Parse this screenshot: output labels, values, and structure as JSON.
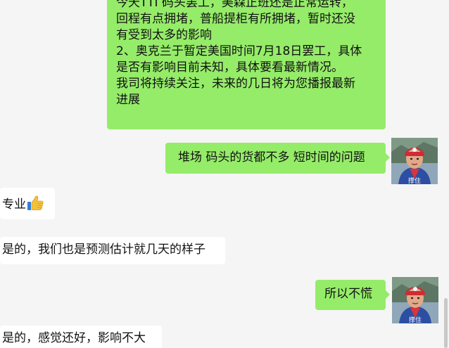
{
  "colors": {
    "background": "#f5f5f5",
    "self_bubble": "#95ec69",
    "other_bubble": "#ffffff"
  },
  "messages": [
    {
      "sender": "self",
      "lines": [
        "今天TTI 码头罢工，美森正班还是正常运转，",
        "回程有点拥堵，普船提柜有所拥堵，暂时还没",
        "有受到太多的影响",
        "2、奥克兰于暂定美国时间7月18日罢工，具体",
        "是否有影响目前未知，具体要看最新情况。",
        "我司将持续关注，未来的几日将为您播报最新",
        "进展"
      ]
    },
    {
      "sender": "self",
      "text": "堆场 码头的货都不多 短时间的问题"
    },
    {
      "sender": "other",
      "text": "专业",
      "emoji": "thumbs-up-icon"
    },
    {
      "sender": "other",
      "text": "是的，我们也是预测估计就几天的样子"
    },
    {
      "sender": "self",
      "text": "所以不慌"
    },
    {
      "sender": "other",
      "text": "是的，感觉还好，影响不大"
    }
  ],
  "avatars": [
    {
      "caption": "撑住"
    },
    {
      "caption": "撑住"
    }
  ]
}
